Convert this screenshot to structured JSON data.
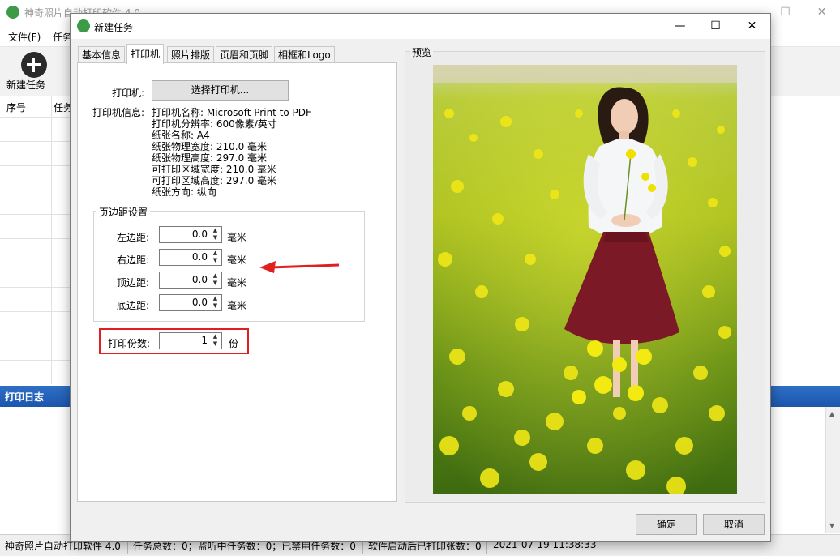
{
  "app": {
    "title": "神奇照片自动打印软件 4.0",
    "menu": [
      "文件(F)",
      "任务"
    ],
    "toolbar_new_task": "新建任务",
    "columns": [
      "序号",
      "任务"
    ],
    "log_title": "打印日志",
    "status": [
      "神奇照片自动打印软件 4.0",
      "任务总数：0；监听中任务数：0；已禁用任务数：0",
      "软件启动后已打印张数：0",
      "2021-07-19 11:38:33"
    ]
  },
  "dialog": {
    "title": "新建任务",
    "tabs": [
      "基本信息",
      "打印机",
      "照片排版",
      "页眉和页脚",
      "相框和Logo"
    ],
    "active_tab": "打印机",
    "printer_label": "打印机:",
    "select_printer_button": "选择打印机...",
    "printer_info_label": "打印机信息:",
    "printer_info": [
      "打印机名称: Microsoft Print to PDF",
      "打印机分辨率: 600像素/英寸",
      "纸张名称: A4",
      "纸张物理宽度: 210.0 毫米",
      "纸张物理高度: 297.0 毫米",
      "可打印区域宽度: 210.0 毫米",
      "可打印区域高度: 297.0 毫米",
      "纸张方向: 纵向"
    ],
    "margin_group_title": "页边距设置",
    "margins": [
      {
        "label": "左边距:",
        "value": "0.0",
        "unit": "毫米"
      },
      {
        "label": "右边距:",
        "value": "0.0",
        "unit": "毫米"
      },
      {
        "label": "顶边距:",
        "value": "0.0",
        "unit": "毫米"
      },
      {
        "label": "底边距:",
        "value": "0.0",
        "unit": "毫米"
      }
    ],
    "copies_label": "打印份数:",
    "copies_value": "1",
    "copies_unit": "份",
    "preview_title": "预览",
    "ok_button": "确定",
    "cancel_button": "取消"
  },
  "colors": {
    "log_header": "#1c56ad",
    "highlight_red": "#e02020",
    "field_green": "#c8d820"
  }
}
